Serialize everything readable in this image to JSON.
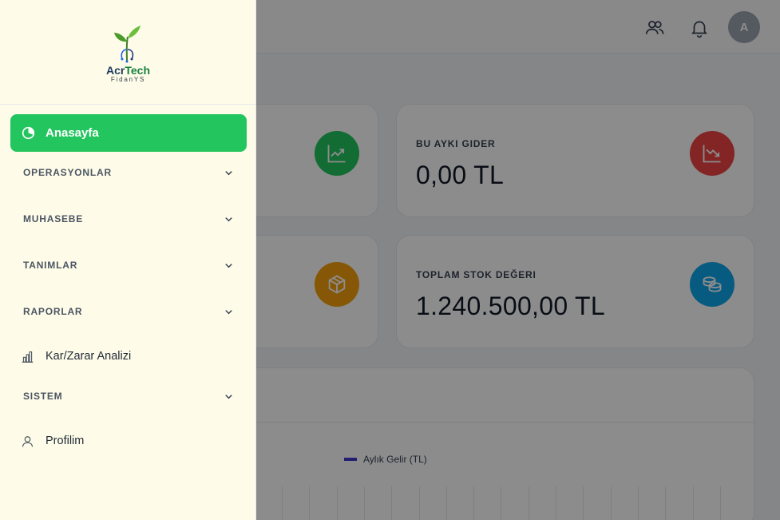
{
  "header": {
    "avatar_initial": "A",
    "icons": [
      "users-icon",
      "bell-icon"
    ]
  },
  "stats": [
    {
      "label": "BU AYKI GIDER",
      "value": "0,00 TL",
      "color": "#ef4444",
      "icon": "trending-down-icon"
    },
    {
      "label": "TOPLAM STOK DEĞERI",
      "value": "1.240.500,00 TL",
      "color": "#0ea5e9",
      "icon": "coins-icon"
    }
  ],
  "partial_cards": [
    {
      "color": "#22c55e",
      "icon": "trending-up-icon"
    },
    {
      "color": "#f59e0b",
      "icon": "box-icon"
    }
  ],
  "chart": {
    "legend": "Aylık Gelir (TL)",
    "legend_color": "#4338ca"
  },
  "sidebar": {
    "brand_part1": "Acr",
    "brand_part2": "Tech",
    "brand_sub": "FidanYS",
    "active_item": "Anasayfa",
    "items": [
      {
        "type": "group",
        "label": "OPERASYONLAR"
      },
      {
        "type": "group",
        "label": "MUHASEBE"
      },
      {
        "type": "group",
        "label": "TANIMLAR"
      },
      {
        "type": "group",
        "label": "RAPORLAR"
      },
      {
        "type": "link",
        "label": "Kar/Zarar Analizi"
      },
      {
        "type": "group",
        "label": "SISTEM"
      },
      {
        "type": "link",
        "label": "Profilim"
      }
    ],
    "accent": "#22c55e"
  }
}
